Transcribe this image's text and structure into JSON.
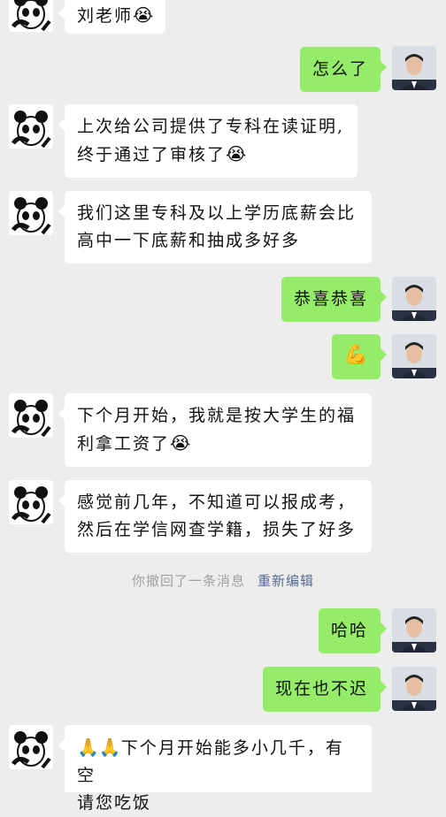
{
  "messages": [
    {
      "side": "left",
      "text": "刘老师",
      "emoji": "😭"
    },
    {
      "side": "right",
      "text": "怎么了"
    },
    {
      "side": "left",
      "line1": "上次给公司提供了专科在读证明,",
      "line2": "终于通过了审核了",
      "emoji": "😭"
    },
    {
      "side": "left",
      "line1": "我们这里专科及以上学历底薪会比",
      "line2": "高中一下底薪和抽成多好多"
    },
    {
      "side": "right",
      "text": "恭喜恭喜"
    },
    {
      "side": "right",
      "emoji": "💪"
    },
    {
      "side": "left",
      "line1": "下个月开始，我就是按大学生的福",
      "line2": "利拿工资了",
      "emoji": "😭"
    },
    {
      "side": "left",
      "line1": "感觉前几年，不知道可以报成考，",
      "line2": "然后在学信网查学籍，损失了好多"
    },
    {
      "side": "right",
      "text": "哈哈"
    },
    {
      "side": "right",
      "text": "现在也不迟"
    },
    {
      "side": "left",
      "emoji": "🙏🙏",
      "line1": "下个月开始能多小几千，有空",
      "line2": "请您吃饭"
    }
  ],
  "recall": {
    "text": "你撤回了一条消息",
    "action": "重新编辑"
  },
  "colors": {
    "background": "#ededed",
    "incoming": "#ffffff",
    "outgoing": "#95ec69",
    "link": "#576b95"
  }
}
